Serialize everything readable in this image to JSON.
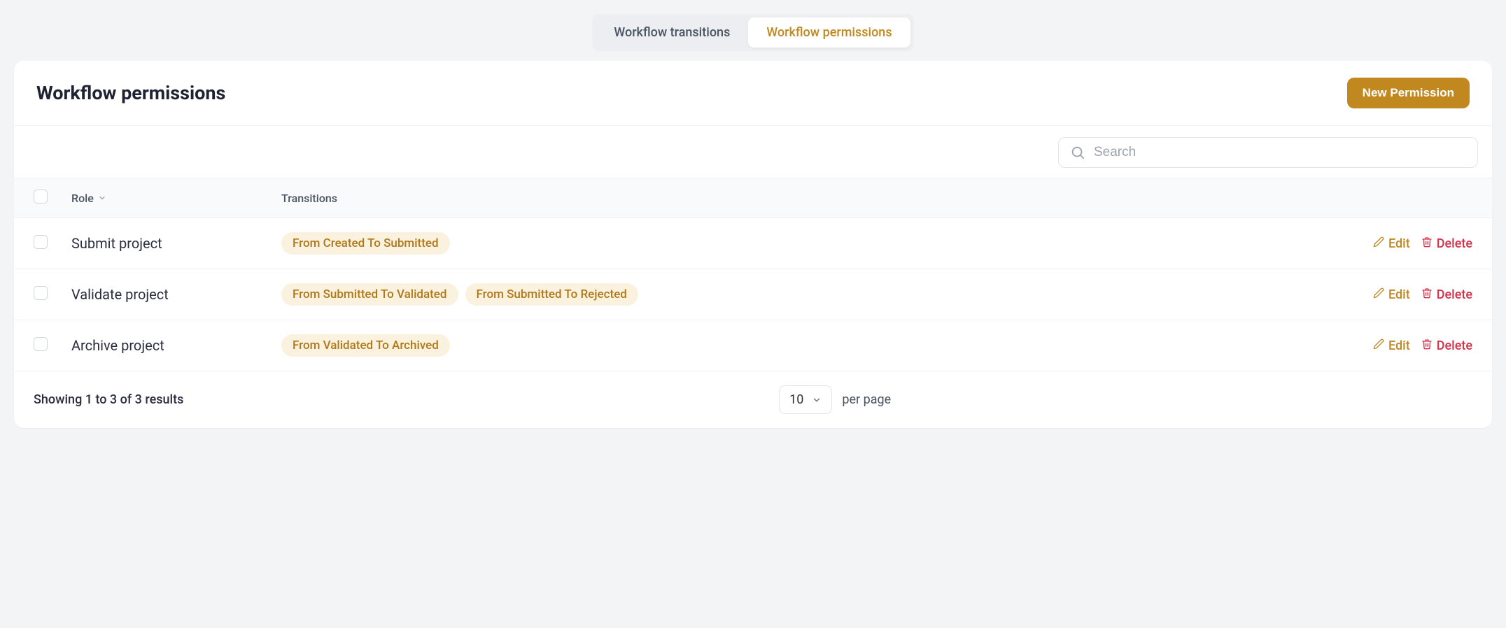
{
  "tabs": {
    "transitions": "Workflow transitions",
    "permissions": "Workflow permissions"
  },
  "header": {
    "title": "Workflow permissions",
    "new_button": "New Permission"
  },
  "search": {
    "placeholder": "Search"
  },
  "table": {
    "headers": {
      "role": "Role",
      "transitions": "Transitions"
    },
    "rows": [
      {
        "role": "Submit project",
        "transitions": [
          "From Created To Submitted"
        ]
      },
      {
        "role": "Validate project",
        "transitions": [
          "From Submitted To Validated",
          "From Submitted To Rejected"
        ]
      },
      {
        "role": "Archive project",
        "transitions": [
          "From Validated To Archived"
        ]
      }
    ],
    "actions": {
      "edit": "Edit",
      "delete": "Delete"
    }
  },
  "footer": {
    "summary": "Showing 1 to 3 of 3 results",
    "page_size": "10",
    "per_page": "per page"
  }
}
